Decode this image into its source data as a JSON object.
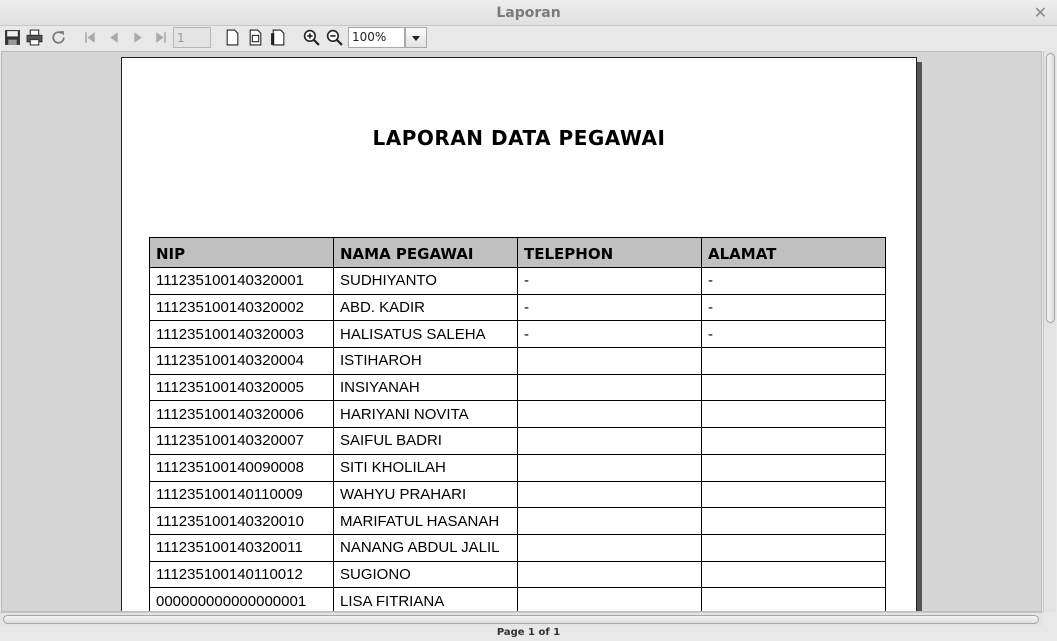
{
  "window": {
    "title": "Laporan"
  },
  "toolbar": {
    "page_number": "1",
    "zoom": "100%"
  },
  "report": {
    "title": "LAPORAN DATA PEGAWAI",
    "columns": [
      "NIP",
      "NAMA PEGAWAI",
      "TELEPHON",
      "ALAMAT"
    ],
    "rows": [
      [
        "111235100140320001",
        "SUDHIYANTO",
        "-",
        "-"
      ],
      [
        "111235100140320002",
        "ABD. KADIR",
        "-",
        "-"
      ],
      [
        "111235100140320003",
        "HALISATUS SALEHA",
        "-",
        "-"
      ],
      [
        "111235100140320004",
        "ISTIHAROH",
        "",
        ""
      ],
      [
        "111235100140320005",
        "INSIYANAH",
        "",
        ""
      ],
      [
        "111235100140320006",
        "HARIYANI NOVITA",
        "",
        ""
      ],
      [
        "111235100140320007",
        "SAIFUL BADRI",
        "",
        ""
      ],
      [
        "111235100140090008",
        "SITI KHOLILAH",
        "",
        ""
      ],
      [
        "111235100140110009",
        "WAHYU PRAHARI",
        "",
        ""
      ],
      [
        "111235100140320010",
        "MARIFATUL HASANAH",
        "",
        ""
      ],
      [
        "111235100140320011",
        "NANANG ABDUL JALIL",
        "",
        ""
      ],
      [
        "111235100140110012",
        "SUGIONO",
        "",
        ""
      ],
      [
        "000000000000000001",
        "LISA FITRIANA",
        "",
        ""
      ]
    ]
  },
  "status": {
    "page_info": "Page 1 of 1"
  },
  "icons": {
    "save": "save-icon",
    "print": "print-icon",
    "reload": "reload-icon",
    "first": "first-page-icon",
    "prev": "previous-page-icon",
    "next": "next-page-icon",
    "last": "last-page-icon",
    "actual_size": "actual-size-icon",
    "fit_page": "fit-page-icon",
    "fit_width": "fit-width-icon",
    "zoom_in": "zoom-in-icon",
    "zoom_out": "zoom-out-icon",
    "dropdown": "chevron-down-icon",
    "close": "close-icon"
  }
}
